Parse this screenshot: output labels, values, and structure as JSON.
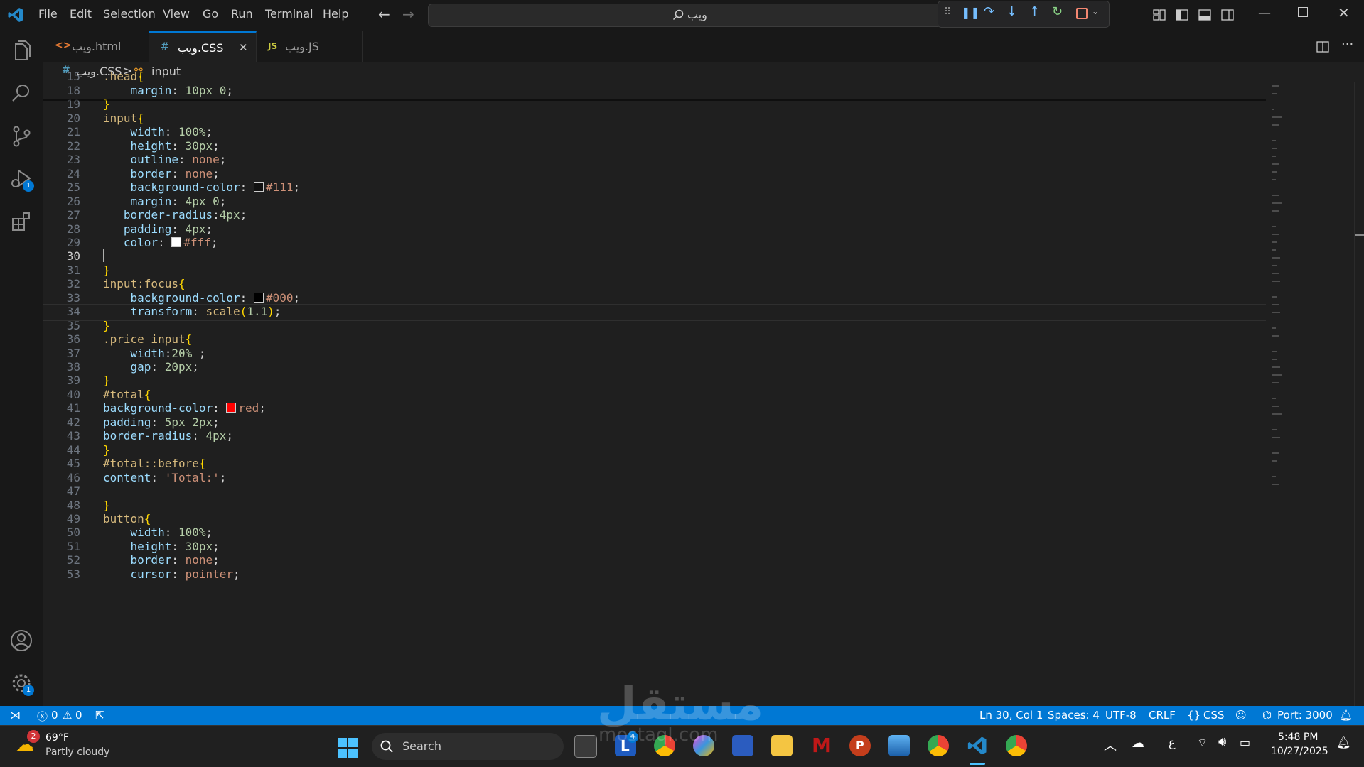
{
  "menu": [
    "File",
    "Edit",
    "Selection",
    "View",
    "Go",
    "Run",
    "Terminal",
    "Help"
  ],
  "search": {
    "text": "ويب"
  },
  "tabs": [
    {
      "icon": "<>",
      "label": "ويب.html"
    },
    {
      "icon": "#",
      "label": "ويب.CSS",
      "close": "✕"
    },
    {
      "icon": "JS",
      "label": "ويب.JS"
    }
  ],
  "breadcrumb": {
    "file_icon": "#",
    "file": "ويب.CSS",
    "separator": ">",
    "symbol": "input"
  },
  "badges": {
    "run_debug": "1",
    "settings": "1"
  },
  "status": {
    "errors": "0",
    "warnings": "0",
    "position": "Ln 30, Col 1",
    "spaces": "Spaces: 4",
    "encoding": "UTF-8",
    "eol": "CRLF",
    "language": "CSS",
    "port": "Port: 3000"
  },
  "taskbar": {
    "weather_badge": "2",
    "temperature": "69°F",
    "weather": "Partly cloudy",
    "search": "Search",
    "time": "5:48 PM",
    "date": "10/27/2025",
    "lang": "ع",
    "app_badge": "4"
  },
  "watermark": {
    "text": "مستقل",
    "sub": "mostaql.com"
  },
  "colors": {
    "accent": "#0078d4",
    "red_swatch": "#ff0000",
    "swatch_111": "#111111",
    "swatch_fff": "#ffffff",
    "swatch_000": "#000000"
  },
  "lines": [
    {
      "n": "15",
      "i": "",
      "t": [
        [
          ".head",
          "sel"
        ],
        [
          "{",
          "br"
        ]
      ]
    },
    {
      "n": "18",
      "i": "    ",
      "t": [
        [
          "margin",
          "prop"
        ],
        [
          ": ",
          ""
        ],
        [
          "10px 0",
          "num"
        ],
        [
          ";",
          ""
        ]
      ]
    },
    {
      "n": "19",
      "i": "",
      "t": [
        [
          "}",
          "br"
        ]
      ]
    },
    {
      "n": "20",
      "i": "",
      "t": [
        [
          "input",
          "sel"
        ],
        [
          "{",
          "br"
        ]
      ]
    },
    {
      "n": "21",
      "i": "    ",
      "t": [
        [
          "width",
          "prop"
        ],
        [
          ": ",
          ""
        ],
        [
          "100%",
          "num"
        ],
        [
          ";",
          ""
        ]
      ]
    },
    {
      "n": "22",
      "i": "    ",
      "t": [
        [
          "height",
          "prop"
        ],
        [
          ": ",
          ""
        ],
        [
          "30px",
          "num"
        ],
        [
          ";",
          ""
        ]
      ]
    },
    {
      "n": "23",
      "i": "    ",
      "t": [
        [
          "outline",
          "prop"
        ],
        [
          ": ",
          ""
        ],
        [
          "none",
          "kw"
        ],
        [
          ";",
          ""
        ]
      ]
    },
    {
      "n": "24",
      "i": "    ",
      "t": [
        [
          "border",
          "prop"
        ],
        [
          ": ",
          ""
        ],
        [
          "none",
          "kw"
        ],
        [
          ";",
          ""
        ]
      ]
    },
    {
      "n": "25",
      "i": "    ",
      "t": [
        [
          "background-color",
          "prop"
        ],
        [
          ": ",
          ""
        ],
        [
          "#111111",
          "swatch"
        ],
        [
          "#111",
          "kw"
        ],
        [
          ";",
          ""
        ]
      ]
    },
    {
      "n": "26",
      "i": "    ",
      "t": [
        [
          "margin",
          "prop"
        ],
        [
          ": ",
          ""
        ],
        [
          "4px 0",
          "num"
        ],
        [
          ";",
          ""
        ]
      ]
    },
    {
      "n": "27",
      "i": "   ",
      "t": [
        [
          "border-radius",
          "prop"
        ],
        [
          ":",
          ""
        ],
        [
          "4px",
          "num"
        ],
        [
          ";",
          ""
        ]
      ]
    },
    {
      "n": "28",
      "i": "   ",
      "t": [
        [
          "padding",
          "prop"
        ],
        [
          ": ",
          ""
        ],
        [
          "4px",
          "num"
        ],
        [
          ";",
          ""
        ]
      ]
    },
    {
      "n": "29",
      "i": "   ",
      "t": [
        [
          "color",
          "prop"
        ],
        [
          ": ",
          ""
        ],
        [
          "#ffffff",
          "swatch"
        ],
        [
          "#fff",
          "kw"
        ],
        [
          ";",
          ""
        ]
      ]
    },
    {
      "n": "30",
      "i": "",
      "t": []
    },
    {
      "n": "31",
      "i": "",
      "t": [
        [
          "}",
          "br"
        ]
      ]
    },
    {
      "n": "32",
      "i": "",
      "t": [
        [
          "input:focus",
          "sel"
        ],
        [
          "{",
          "br"
        ]
      ]
    },
    {
      "n": "33",
      "i": "    ",
      "t": [
        [
          "background-color",
          "prop"
        ],
        [
          ": ",
          ""
        ],
        [
          "#000000",
          "swatch"
        ],
        [
          "#000",
          "kw"
        ],
        [
          ";",
          ""
        ]
      ]
    },
    {
      "n": "34",
      "i": "    ",
      "t": [
        [
          "transform",
          "prop"
        ],
        [
          ": ",
          ""
        ],
        [
          "scale",
          "sel"
        ],
        [
          "(",
          "br"
        ],
        [
          "1.1",
          "num"
        ],
        [
          ")",
          "br"
        ],
        [
          ";",
          ""
        ]
      ]
    },
    {
      "n": "35",
      "i": "",
      "t": [
        [
          "}",
          "br"
        ]
      ]
    },
    {
      "n": "36",
      "i": "",
      "t": [
        [
          ".price input",
          "sel"
        ],
        [
          "{",
          "br"
        ]
      ]
    },
    {
      "n": "37",
      "i": "    ",
      "t": [
        [
          "width",
          "prop"
        ],
        [
          ":",
          ""
        ],
        [
          "20%",
          "num"
        ],
        [
          " ;",
          ""
        ]
      ]
    },
    {
      "n": "38",
      "i": "    ",
      "t": [
        [
          "gap",
          "prop"
        ],
        [
          ": ",
          ""
        ],
        [
          "20px",
          "num"
        ],
        [
          ";",
          ""
        ]
      ]
    },
    {
      "n": "39",
      "i": "",
      "t": [
        [
          "}",
          "br"
        ]
      ]
    },
    {
      "n": "40",
      "i": "",
      "t": [
        [
          "#total",
          "sel"
        ],
        [
          "{",
          "br"
        ]
      ]
    },
    {
      "n": "41",
      "i": "",
      "t": [
        [
          "background-color",
          "prop"
        ],
        [
          ": ",
          ""
        ],
        [
          "#ff0000",
          "swatch"
        ],
        [
          "red",
          "kw"
        ],
        [
          ";",
          ""
        ]
      ]
    },
    {
      "n": "42",
      "i": "",
      "t": [
        [
          "padding",
          "prop"
        ],
        [
          ": ",
          ""
        ],
        [
          "5px 2px",
          "num"
        ],
        [
          ";",
          ""
        ]
      ]
    },
    {
      "n": "43",
      "i": "",
      "t": [
        [
          "border-radius",
          "prop"
        ],
        [
          ": ",
          ""
        ],
        [
          "4px",
          "num"
        ],
        [
          ";",
          ""
        ]
      ]
    },
    {
      "n": "44",
      "i": "",
      "t": [
        [
          "}",
          "br"
        ]
      ]
    },
    {
      "n": "45",
      "i": "",
      "t": [
        [
          "#total::before",
          "sel"
        ],
        [
          "{",
          "br"
        ]
      ]
    },
    {
      "n": "46",
      "i": "",
      "t": [
        [
          "content",
          "prop"
        ],
        [
          ": ",
          ""
        ],
        [
          "'Total:'",
          "str"
        ],
        [
          ";",
          ""
        ]
      ]
    },
    {
      "n": "47",
      "i": "",
      "t": []
    },
    {
      "n": "48",
      "i": "",
      "t": [
        [
          "}",
          "br"
        ]
      ]
    },
    {
      "n": "49",
      "i": "",
      "t": [
        [
          "button",
          "sel"
        ],
        [
          "{",
          "br"
        ]
      ]
    },
    {
      "n": "50",
      "i": "    ",
      "t": [
        [
          "width",
          "prop"
        ],
        [
          ": ",
          ""
        ],
        [
          "100%",
          "num"
        ],
        [
          ";",
          ""
        ]
      ]
    },
    {
      "n": "51",
      "i": "    ",
      "t": [
        [
          "height",
          "prop"
        ],
        [
          ": ",
          ""
        ],
        [
          "30px",
          "num"
        ],
        [
          ";",
          ""
        ]
      ]
    },
    {
      "n": "52",
      "i": "    ",
      "t": [
        [
          "border",
          "prop"
        ],
        [
          ": ",
          ""
        ],
        [
          "none",
          "kw"
        ],
        [
          ";",
          ""
        ]
      ]
    },
    {
      "n": "53",
      "i": "    ",
      "t": [
        [
          "cursor",
          "prop"
        ],
        [
          ": ",
          ""
        ],
        [
          "pointer",
          "kw"
        ],
        [
          ";",
          ""
        ]
      ]
    }
  ]
}
